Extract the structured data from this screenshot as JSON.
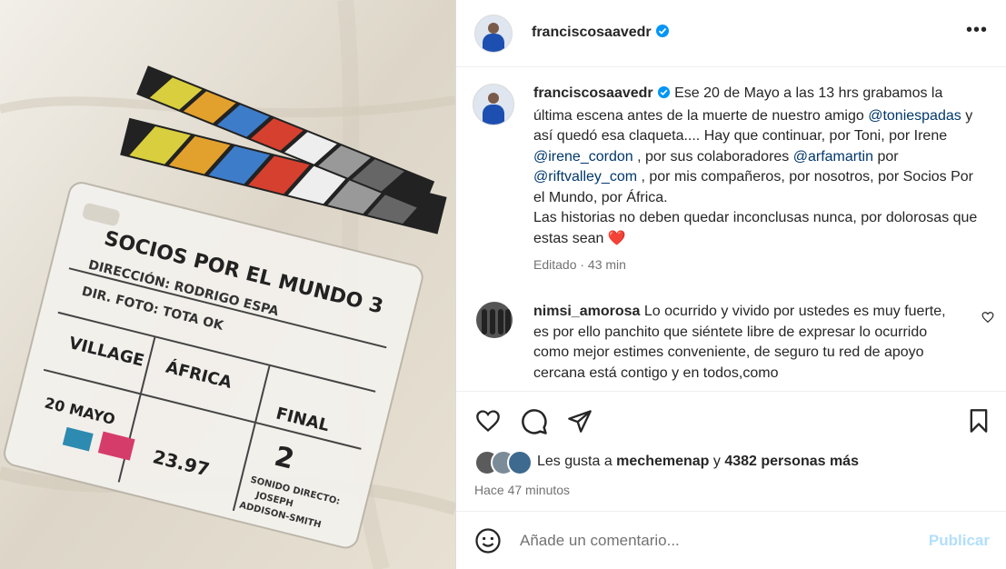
{
  "post": {
    "username": "franciscosaavedr",
    "more_label": "•••"
  },
  "caption": {
    "username": "franciscosaavedr",
    "parts": {
      "p1": " Ese 20 de Mayo a las 13 hrs grabamos la última escena antes de la muerte de nuestro amigo ",
      "m1": "@toniespadas",
      "p2": " y así quedó esa claqueta.... Hay que continuar, por Toni, por Irene ",
      "m2": "@irene_cordon",
      "p3": " , por sus colaboradores ",
      "m3": "@arfamartin",
      "p4": " por ",
      "m4": "@riftvalley_com",
      "p5": " , por mis compañeros, por nosotros, por Socios Por el Mundo, por África.",
      "p6": "Las historias no deben quedar inconclusas nunca, por dolorosas que estas sean "
    },
    "emoji": "❤️",
    "edited": "Editado · 43 min"
  },
  "comment": {
    "username": "nimsi_amorosa",
    "text": " Lo ocurrido y vivido por ustedes es muy fuerte, es por ello panchito que siéntete libre de expresar lo ocurrido como mejor estimes conveniente, de seguro tu red de apoyo cercana está contigo y en todos,como"
  },
  "likes": {
    "prefix": "Les gusta a ",
    "user": "mechemenap",
    "middle": " y ",
    "count": "4382 personas más"
  },
  "time": "Hace 47 minutos",
  "add_comment": {
    "placeholder": "Añade un comentario...",
    "publish": "Publicar"
  },
  "colors": {
    "verified": "#0095f6",
    "mention": "#00376b",
    "publish_disabled": "#b2dffc"
  },
  "icons": [
    "heart-icon",
    "comment-icon",
    "share-icon",
    "bookmark-icon",
    "emoji-icon",
    "more-icon",
    "verified-icon"
  ]
}
